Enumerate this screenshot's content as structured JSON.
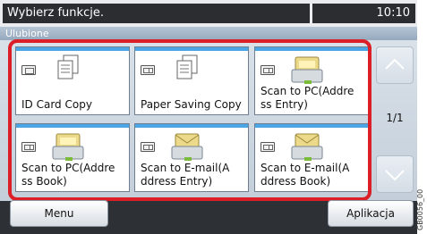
{
  "header": {
    "title": "Wybierz funkcje.",
    "clock": "10:10"
  },
  "section": {
    "title": "Ulubione"
  },
  "favorites": [
    {
      "label": "ID Card Copy",
      "icon": "id-card-copy-icon"
    },
    {
      "label": "Paper Saving Copy",
      "icon": "paper-saving-copy-icon"
    },
    {
      "label": "Scan to PC(Addre\nss Entry)",
      "icon": "scan-to-pc-icon"
    },
    {
      "label": "Scan to PC(Addre\nss Book)",
      "icon": "scan-to-pc-icon"
    },
    {
      "label": "Scan to E-mail(A\nddress Entry)",
      "icon": "scan-to-email-icon"
    },
    {
      "label": "Scan to E-mail(A\nddress Book)",
      "icon": "scan-to-email-icon"
    }
  ],
  "pager": {
    "indicator": "1/1"
  },
  "footer": {
    "menu_label": "Menu",
    "app_label": "Aplikacja"
  },
  "side_code": "GB0056_00",
  "colors": {
    "highlight": "#dc1e26",
    "tile_top": "#4aa6e4",
    "title_bar": "#2b2d31"
  }
}
